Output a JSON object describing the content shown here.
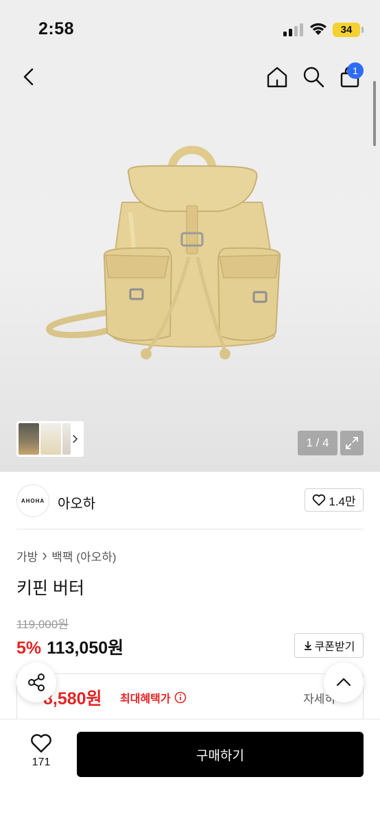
{
  "status_bar": {
    "time": "2:58",
    "battery": "34"
  },
  "header": {
    "cart_count": "1"
  },
  "gallery": {
    "counter": "1 / 4"
  },
  "brand": {
    "logo_text": "AHOHA",
    "name": "아오하",
    "likes": "1.4만"
  },
  "breadcrumb": {
    "category": "가방",
    "subcategory": "백팩 (아오하)"
  },
  "product": {
    "title": "키핀 버터",
    "original_price": "119,000원",
    "discount": "5%",
    "sale_price": "113,050원",
    "coupon_label": "쿠폰받기"
  },
  "benefit": {
    "price": "8,580원",
    "label": "최대혜택가",
    "detail": "자세히"
  },
  "bottom": {
    "wish_count": "171",
    "buy_label": "구매하기"
  },
  "colors": {
    "accent_red": "#e32525",
    "badge_blue": "#2f6cf6",
    "buy_button": "#000000",
    "product_tan": "#e3cf92"
  }
}
